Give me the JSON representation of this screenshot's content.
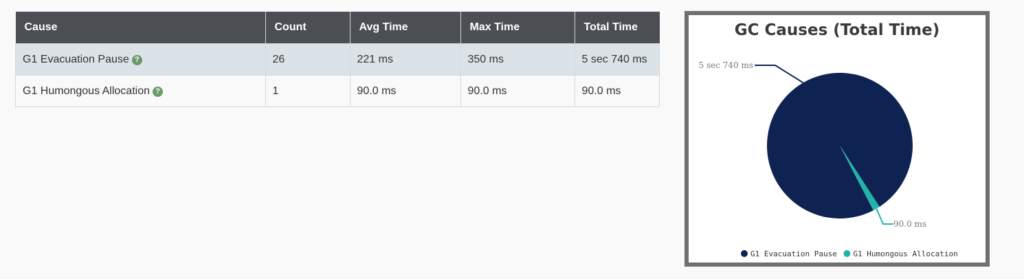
{
  "table": {
    "headers": [
      "Cause",
      "Count",
      "Avg Time",
      "Max Time",
      "Total Time"
    ],
    "rows": [
      {
        "cause": "G1 Evacuation Pause",
        "help_icon": "question-circle-icon",
        "count": "26",
        "avg_time": "221 ms",
        "max_time": "350 ms",
        "total_time": "5 sec 740 ms"
      },
      {
        "cause": "G1 Humongous Allocation",
        "help_icon": "question-circle-icon",
        "count": "1",
        "avg_time": "90.0 ms",
        "max_time": "90.0 ms",
        "total_time": "90.0 ms"
      }
    ]
  },
  "colors": {
    "header_bg": "#4b4e52",
    "row_highlight": "#dce3e8",
    "help_icon": "#6d9a6a",
    "slice_1": "#0f2353",
    "slice_2": "#1fb3aa"
  },
  "chart_data": {
    "type": "pie",
    "title": "GC Causes (Total Time)",
    "slices": [
      {
        "label": "G1 Evacuation Pause",
        "value": 5740,
        "display": "5 sec 740 ms",
        "color": "#0f2353"
      },
      {
        "label": "G1 Humongous Allocation",
        "value": 90,
        "display": "90.0 ms",
        "color": "#1fb3aa"
      }
    ],
    "legend": {
      "position": "bottom",
      "entries": [
        "G1 Evacuation Pause",
        "G1 Humongous Allocation"
      ]
    }
  }
}
